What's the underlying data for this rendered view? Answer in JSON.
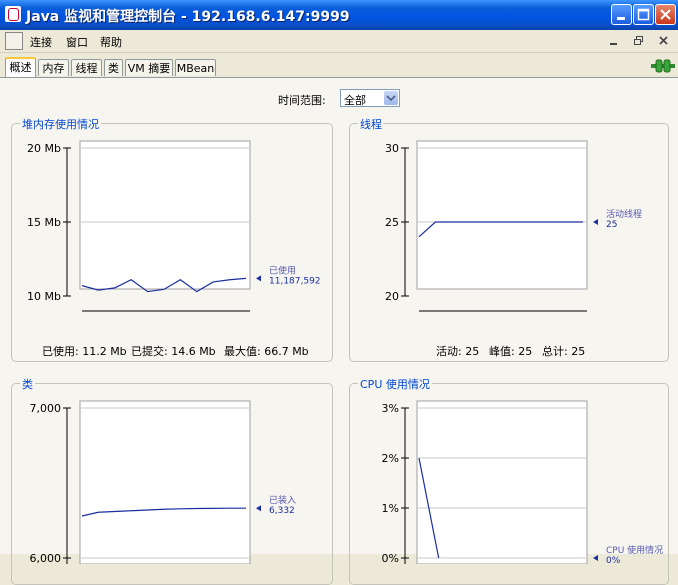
{
  "window": {
    "title": "Java 监视和管理控制台 - 192.168.6.147:9999"
  },
  "menu": {
    "items": [
      "连接",
      "窗口",
      "帮助"
    ]
  },
  "tabs": [
    "概述",
    "内存",
    "线程",
    "类",
    "VM 摘要",
    "MBean"
  ],
  "overview": {
    "range_label": "时间范围:",
    "range_value": "全部"
  },
  "colors": {
    "series": "#1a2ea0",
    "title": "#0046d5",
    "grid": "#c8c8c8"
  },
  "panels": {
    "heap": {
      "title": "堆内存使用情况",
      "stats": {
        "used": "已使用: 11.2 Mb",
        "committed": "已提交: 14.6 Mb",
        "max": "最大值: 66.7 Mb"
      }
    },
    "threads": {
      "title": "线程",
      "stats": {
        "live": "活动: 25",
        "peak": "峰值: 25",
        "total": "总计: 25"
      }
    },
    "classes": {
      "title": "类"
    },
    "cpu": {
      "title": "CPU 使用情况"
    }
  },
  "chart_data": [
    {
      "type": "line",
      "title": "堆内存使用情况",
      "y_ticks": [
        "20 Mb",
        "15 Mb",
        "10 Mb"
      ],
      "tick_values": [
        20,
        15,
        10
      ],
      "ylim": [
        10,
        20
      ],
      "unit": "Mb",
      "series": [
        {
          "name": "已使用",
          "values": [
            10.7,
            10.4,
            10.55,
            11.1,
            10.3,
            10.45,
            11.1,
            10.3,
            10.95,
            11.1,
            11.19
          ],
          "label": "已使用",
          "value_label": "11,187,592"
        }
      ]
    },
    {
      "type": "line",
      "title": "线程",
      "y_ticks": [
        "30",
        "25",
        "20"
      ],
      "tick_values": [
        30,
        25,
        20
      ],
      "ylim": [
        20,
        30
      ],
      "series": [
        {
          "name": "活动线程",
          "values": [
            24,
            25,
            25,
            25,
            25,
            25,
            25,
            25,
            25,
            25,
            25
          ],
          "label": "活动线程",
          "value_label": "25"
        }
      ]
    },
    {
      "type": "line",
      "title": "类",
      "y_ticks": [
        "7,000",
        "6,000"
      ],
      "tick_values": [
        7000,
        6000
      ],
      "ylim": [
        6000,
        7000
      ],
      "series": [
        {
          "name": "已装入",
          "values": [
            6280,
            6305,
            6310,
            6315,
            6320,
            6325,
            6328,
            6330,
            6331,
            6332,
            6332
          ],
          "label": "已装入",
          "value_label": "6,332"
        }
      ]
    },
    {
      "type": "line",
      "title": "CPU 使用情况",
      "y_ticks": [
        "3%",
        "2%",
        "1%",
        "0%"
      ],
      "tick_values": [
        3,
        2,
        1,
        0
      ],
      "ylim": [
        0,
        3
      ],
      "unit": "%",
      "series": [
        {
          "name": "CPU 使用情况",
          "values": [
            2.0,
            0.0
          ],
          "label": "CPU 使用情况",
          "value_label": "0%"
        }
      ]
    }
  ]
}
